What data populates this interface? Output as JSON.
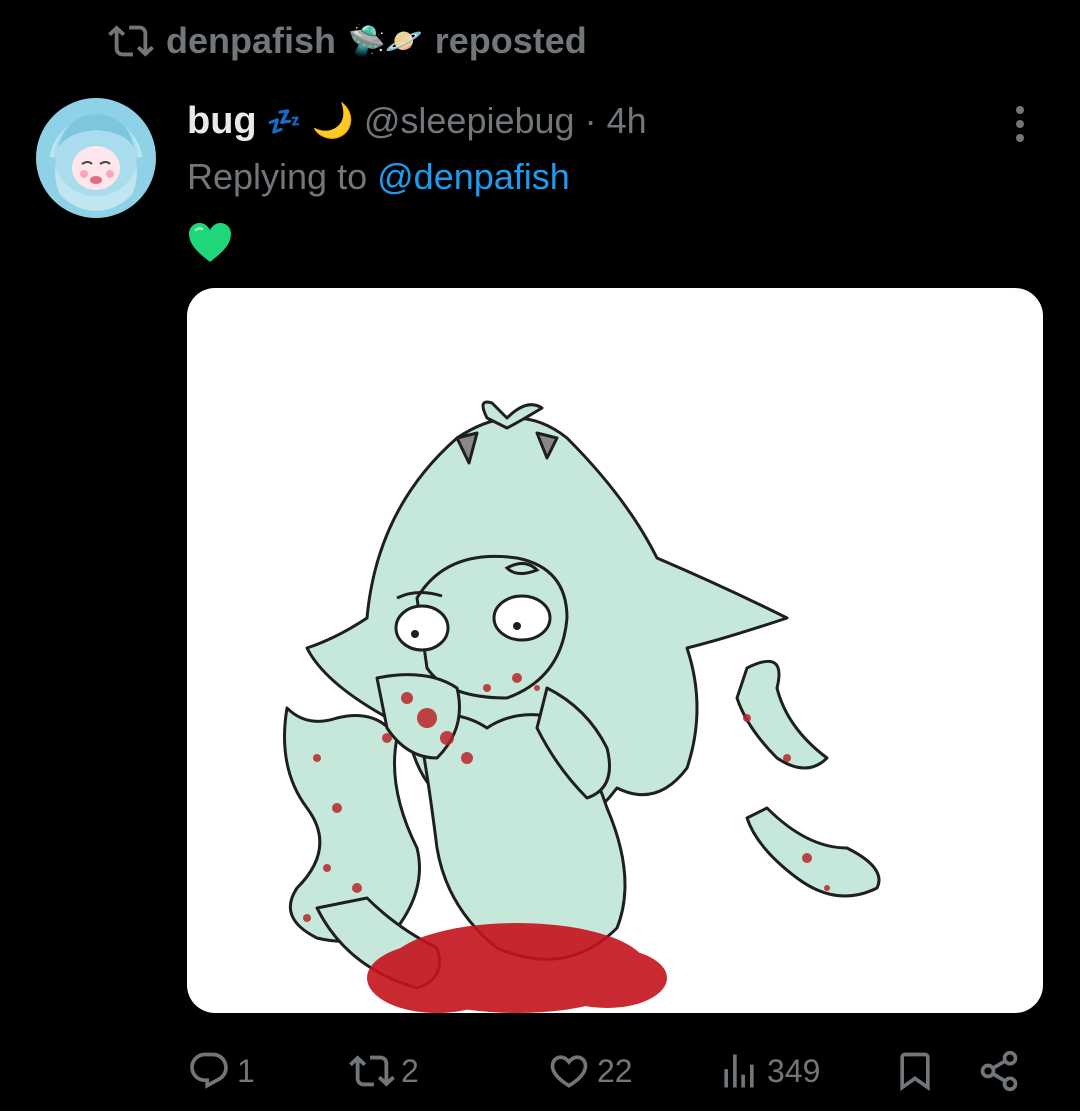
{
  "repost": {
    "icon": "repost-icon",
    "user": "denpafish",
    "emojis": "🛸🪐",
    "label": "reposted"
  },
  "tweet": {
    "author_name": "bug",
    "author_emoji": "💤",
    "author_moon": "🌙",
    "handle": "@sleepiebug",
    "separator": "·",
    "time": "4h",
    "reply_prefix": "Replying to",
    "reply_to": "@denpafish",
    "text": "💚",
    "media": "image",
    "accent_color": "#1d9bf0"
  },
  "actions": {
    "replies": "1",
    "reposts": "2",
    "likes": "22",
    "views": "349"
  }
}
